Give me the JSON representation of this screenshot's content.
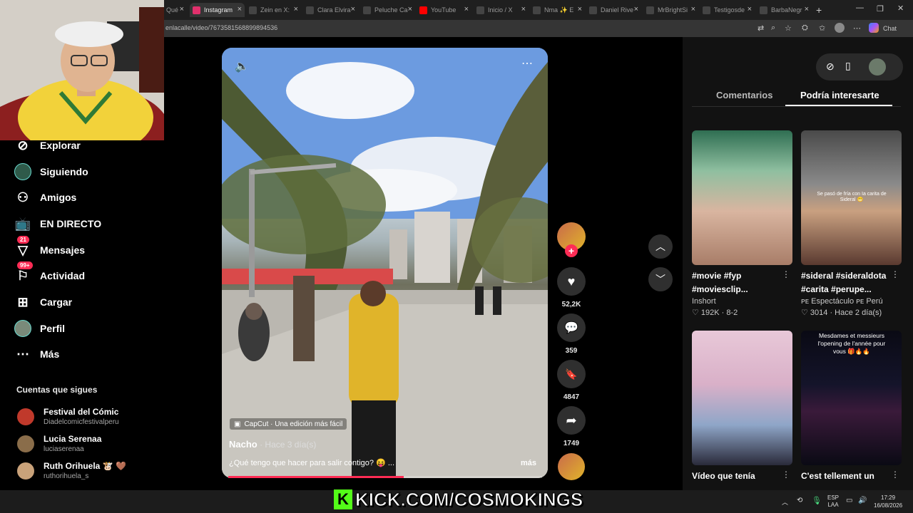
{
  "browser": {
    "tabs": [
      {
        "label": "Qué",
        "fav": "#3a3a3a",
        "active": false
      },
      {
        "label": "Instagram",
        "fav": "#e1306c",
        "active": true
      },
      {
        "label": "Zein en X:",
        "fav": "#444",
        "active": false
      },
      {
        "label": "Clara Elvira",
        "fav": "#444",
        "active": false
      },
      {
        "label": "Peluche Ca",
        "fav": "#444",
        "active": false
      },
      {
        "label": "YouTube",
        "fav": "#ff0000",
        "active": false
      },
      {
        "label": "Inicio / X",
        "fav": "#444",
        "active": false
      },
      {
        "label": "Nma ✨ E",
        "fav": "#444",
        "active": false
      },
      {
        "label": "Daniel Rive",
        "fav": "#444",
        "active": false
      },
      {
        "label": "MrBrightSi",
        "fav": "#444",
        "active": false
      },
      {
        "label": "Testigosde",
        "fav": "#444",
        "active": false
      },
      {
        "label": "BarbaNegr",
        "fav": "#444",
        "active": false
      }
    ],
    "url": "enlacalle/video/7673581568899894536",
    "chat_label": "Chat"
  },
  "sidebar": {
    "items": [
      {
        "label": "Explorar",
        "icon": "compass-icon"
      },
      {
        "label": "Siguiendo",
        "icon": "following-avatar-icon"
      },
      {
        "label": "Amigos",
        "icon": "friends-icon"
      },
      {
        "label": "EN DIRECTO",
        "icon": "live-tv-icon"
      },
      {
        "label": "Mensajes",
        "icon": "messages-icon",
        "badge": "21"
      },
      {
        "label": "Actividad",
        "icon": "activity-icon",
        "badge": "99+"
      },
      {
        "label": "Cargar",
        "icon": "upload-icon"
      },
      {
        "label": "Perfil",
        "icon": "profile-avatar-icon"
      },
      {
        "label": "Más",
        "icon": "more-icon"
      }
    ],
    "following_title": "Cuentas que sigues",
    "accounts": [
      {
        "name": "Festival del Cómic",
        "handle": "Diadelcomicfestivalperu",
        "color": "#c0392b"
      },
      {
        "name": "Lucia Serenaa",
        "handle": "luciaserenaa",
        "color": "#8a6d4a"
      },
      {
        "name": "Ruth Orihuela 🐮 🤎",
        "handle": "ruthorihuela_s",
        "color": "#c9a27a"
      }
    ]
  },
  "video": {
    "overlay_badge": "CapCut · Una edición más fácil",
    "author": "Nacho",
    "date": " · Hace 3 día(s)",
    "caption": "¿Qué tengo que hacer para salir contigo? 😝 ...",
    "more_label": "más",
    "progress": 0.56,
    "likes": "52,2K",
    "comments": "359",
    "saves": "4847",
    "shares": "1749"
  },
  "panel": {
    "tabs": [
      "Comentarios",
      "Podría interesarte"
    ],
    "cards": [
      {
        "title1": "#movie #fyp",
        "title2": "#moviesclip...",
        "user": "Inshort",
        "stats": "♡ 192K · 8-2",
        "bg": "linear-gradient(180deg,#2f6e52 0%,#8fbfa0 30%,#d9b5a0 60%,#a87d68 100%)"
      },
      {
        "title1": "#sideral #sideraldota",
        "title2": "#carita #perupe...",
        "user": "ᴘᴇ Espectáculo ᴘᴇ Perú",
        "stats": "♡ 3014 · Hace 2 día(s)",
        "bg": "linear-gradient(180deg,#4a4a4a 0%,#8a8a8a 40%,#c9a080 60%,#5a3a30 100%)",
        "overlay": "Se pasó de fría con Ia carita de Sideral 😬"
      },
      {
        "title1": "Vídeo que tenía",
        "title2": "",
        "user": "",
        "stats": "",
        "bg": "linear-gradient(180deg,#e8c8d8 0%,#d9b0c8 40%,#8fa6c8 70%,#2a2a3a 100%)"
      },
      {
        "title1": "C'est tellement un",
        "title2": "",
        "user": "",
        "stats": "",
        "bg": "linear-gradient(180deg,#0a0a14 0%,#14142a 40%,#3a1a3a 60%,#0a0a14 100%)",
        "overlay": "Mesdames et messieurs l'opening de l'année pour vous 🎁🔥🔥"
      }
    ]
  },
  "stream": {
    "kick_text": "KICK.COM/COSMOKINGS"
  },
  "taskbar": {
    "lang1": "ESP",
    "lang2": "LAA",
    "time": "17:29",
    "date": "16/08/2026"
  }
}
